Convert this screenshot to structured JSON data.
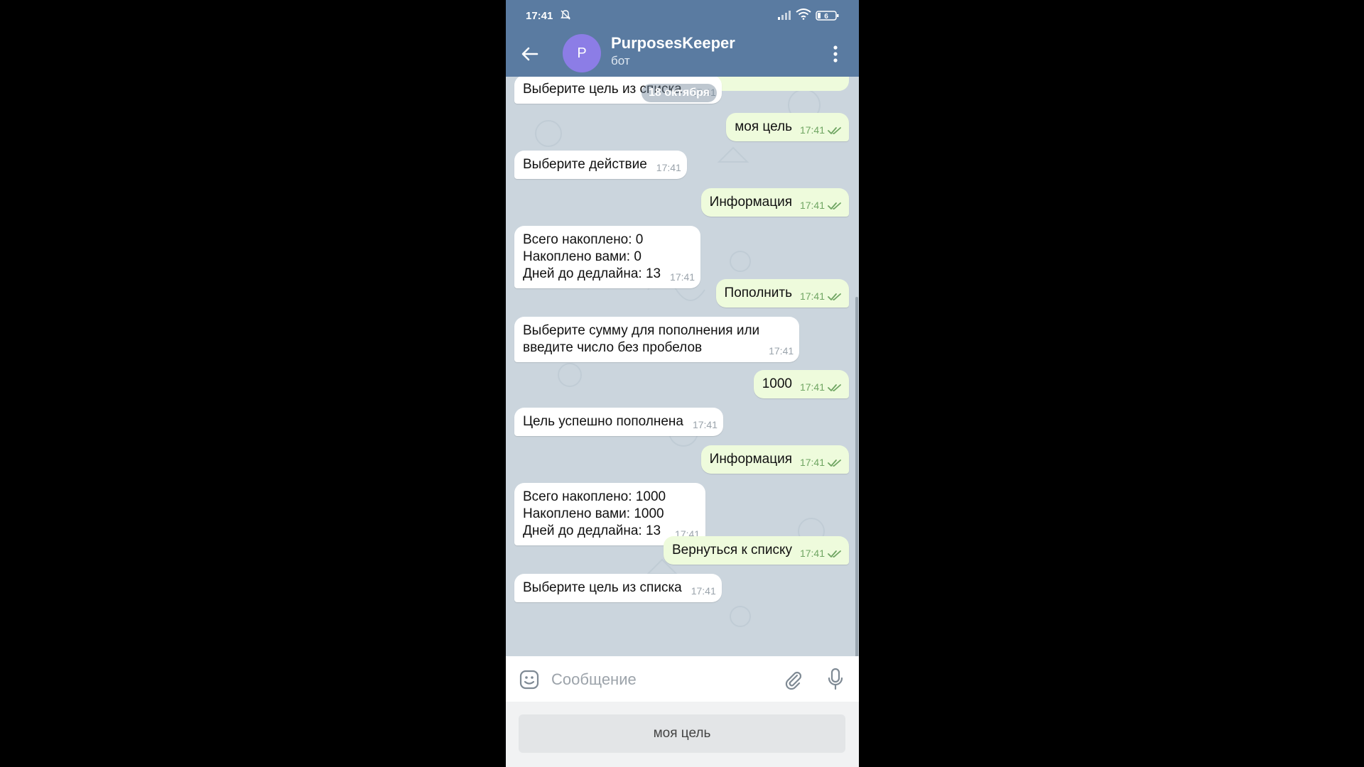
{
  "status_bar": {
    "time": "17:41",
    "battery": "6"
  },
  "header": {
    "avatar_letter": "P",
    "title": "PurposesKeeper",
    "subtitle": "бот"
  },
  "chat": {
    "date": "18 октября",
    "messages": [
      {
        "dir": "in",
        "text": "Выберите цель из списка",
        "time": "17:41"
      },
      {
        "dir": "out",
        "text": "моя цель",
        "time": "17:41"
      },
      {
        "dir": "in",
        "text": "Выберите действие",
        "time": "17:41"
      },
      {
        "dir": "out",
        "text": "Информация",
        "time": "17:41"
      },
      {
        "dir": "in",
        "text": "Всего накоплено: 0\nНакоплено вами: 0\nДней до дедлайна: 13",
        "time": "17:41"
      },
      {
        "dir": "out",
        "text": "Пополнить",
        "time": "17:41"
      },
      {
        "dir": "in",
        "text": "Выберите сумму для пополнения или\nвведите число без пробелов",
        "time": "17:41"
      },
      {
        "dir": "out",
        "text": "1000",
        "time": "17:41"
      },
      {
        "dir": "in",
        "text": "Цель успешно пополнена",
        "time": "17:41"
      },
      {
        "dir": "out",
        "text": "Информация",
        "time": "17:41"
      },
      {
        "dir": "in",
        "text": "Всего накоплено: 1000\nНакоплено вами: 1000\nДней до дедлайна: 13",
        "time": "17:41"
      },
      {
        "dir": "out",
        "text": "Вернуться к списку",
        "time": "17:41"
      },
      {
        "dir": "in",
        "text": "Выберите цель из списка",
        "time": "17:41"
      }
    ]
  },
  "input": {
    "placeholder": "Сообщение"
  },
  "keyboard": {
    "button_label": "моя цель"
  },
  "colors": {
    "header": "#5a7ba1",
    "outgoing": "#eefbdc",
    "incoming": "#ffffff",
    "avatar": "#8c7de6"
  }
}
